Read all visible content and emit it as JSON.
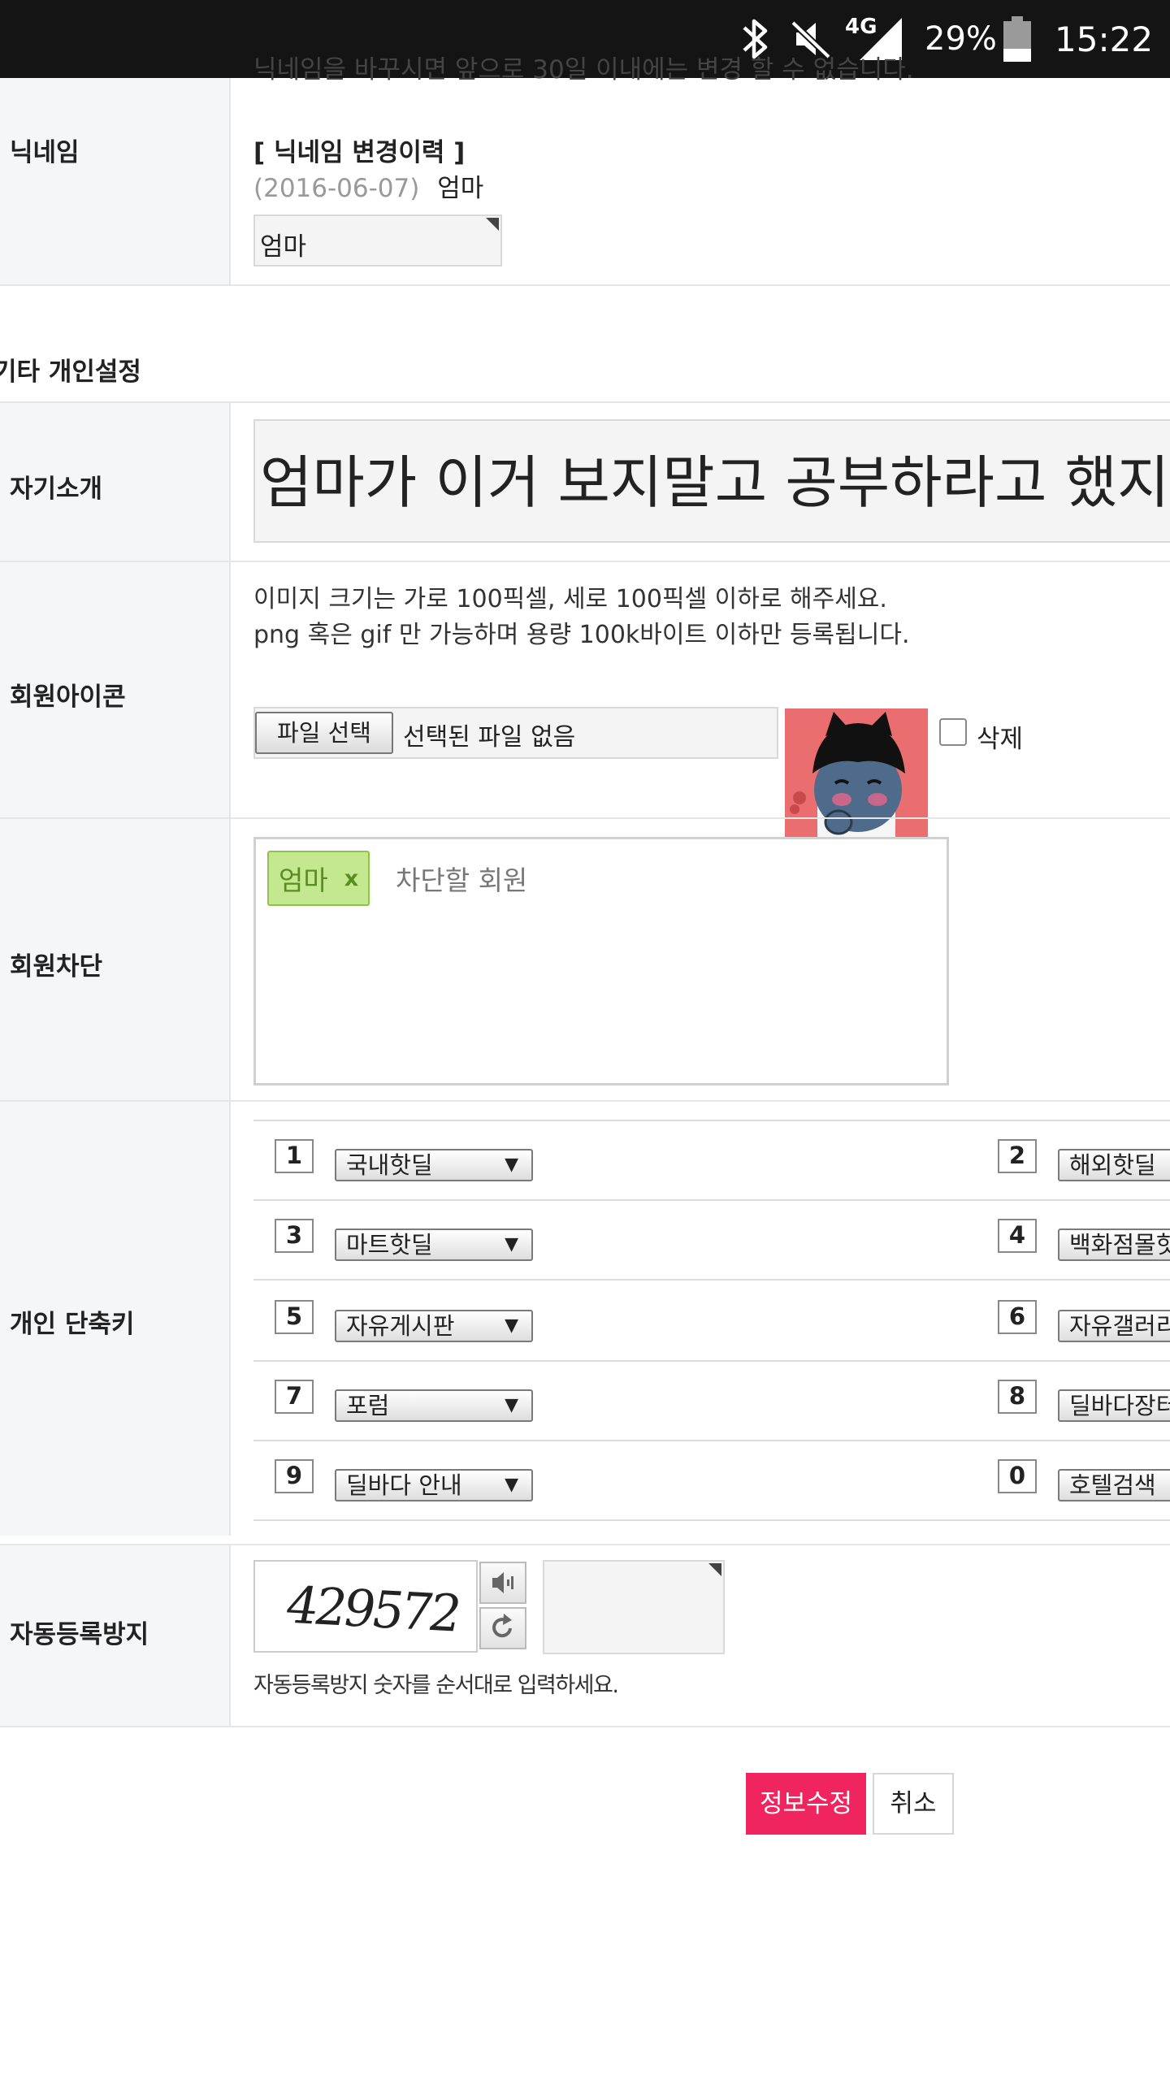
{
  "status_bar": {
    "network": "4G",
    "battery": "29%",
    "time": "15:22"
  },
  "top_partial_text": "닉네임을 바꾸시면 앞으로 30일 이내에는 변경 할 수 없습니다.",
  "nickname": {
    "label": "닉네임",
    "history_title": "[ 닉네임 변경이력 ]",
    "history_date": "(2016-06-07)",
    "history_name": "엄마",
    "value": "엄마"
  },
  "section_title": "기타 개인설정",
  "intro": {
    "label": "자기소개",
    "value": "엄마가 이거 보지말고 공부하라고 했지"
  },
  "icon": {
    "label": "회원아이콘",
    "note1": "이미지 크기는 가로 100픽셀, 세로 100픽셀 이하로 해주세요.",
    "note2": "png 혹은 gif 만 가능하며 용량 100k바이트 이하만 등록됩니다.",
    "file_button": "파일 선택",
    "file_status": "선택된 파일 없음",
    "delete_label": "삭제"
  },
  "block": {
    "label": "회원차단",
    "tag": "엄마",
    "tag_remove": "x",
    "placeholder": "차단할 회원"
  },
  "shortcuts": {
    "label": "개인 단축키",
    "items": [
      {
        "num": "1",
        "value": "국내핫딜"
      },
      {
        "num": "2",
        "value": "해외핫딜"
      },
      {
        "num": "3",
        "value": "마트핫딜"
      },
      {
        "num": "4",
        "value": "백화점몰핫딜"
      },
      {
        "num": "5",
        "value": "자유게시판"
      },
      {
        "num": "6",
        "value": "자유갤러리"
      },
      {
        "num": "7",
        "value": "포럼"
      },
      {
        "num": "8",
        "value": "딜바다장터"
      },
      {
        "num": "9",
        "value": "딜바다 안내"
      },
      {
        "num": "0",
        "value": "호텔검색"
      }
    ]
  },
  "captcha": {
    "label": "자동등록방지",
    "code": "429572",
    "hint": "자동등록방지 숫자를 순서대로 입력하세요."
  },
  "buttons": {
    "submit": "정보수정",
    "cancel": "취소"
  },
  "colors": {
    "submit_bg": "#f0245e",
    "tag_bg": "#c4e890",
    "tag_border": "#8fc24a",
    "avatar_bg": "#ea6d70"
  }
}
